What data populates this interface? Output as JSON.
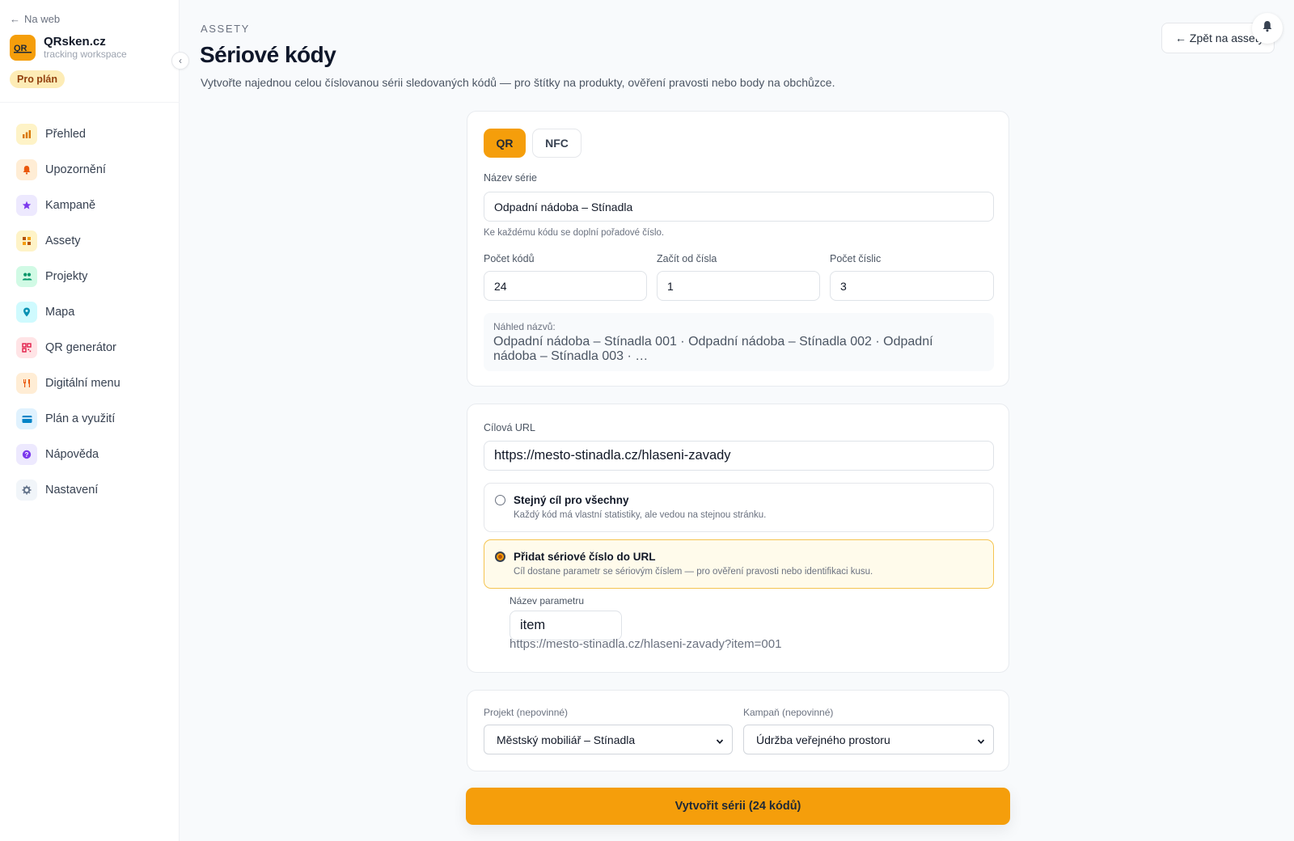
{
  "colors": {
    "accent": "#f59e0b",
    "accent_soft": "#fffbeb",
    "badge_bg": "#fdecb6"
  },
  "sidebar": {
    "back_link": "Na web",
    "brand_name": "QRsken.cz",
    "brand_sub": "tracking workspace",
    "plan_badge": "Pro plán",
    "items": [
      {
        "label": "Přehled",
        "icon": "bar-chart-icon"
      },
      {
        "label": "Upozornění",
        "icon": "bell-icon"
      },
      {
        "label": "Kampaně",
        "icon": "star-icon"
      },
      {
        "label": "Assety",
        "icon": "grid-icon"
      },
      {
        "label": "Projekty",
        "icon": "users-icon"
      },
      {
        "label": "Mapa",
        "icon": "map-pin-icon"
      },
      {
        "label": "QR generátor",
        "icon": "qr-icon"
      },
      {
        "label": "Digitální menu",
        "icon": "cutlery-icon"
      },
      {
        "label": "Plán a využití",
        "icon": "credit-card-icon"
      },
      {
        "label": "Nápověda",
        "icon": "help-icon"
      },
      {
        "label": "Nastavení",
        "icon": "gear-icon"
      }
    ]
  },
  "header": {
    "eyebrow": "ASSETY",
    "title": "Sériové kódy",
    "description": "Vytvořte najednou celou číslovanou sérii sledovaných kódů — pro štítky na produkty, ověření pravosti nebo body na obchůzce.",
    "back_button": "← Zpět na assety"
  },
  "series": {
    "type_tabs": [
      "QR",
      "NFC"
    ],
    "selected_type": "QR",
    "name_label": "Název série",
    "name_value": "Odpadní nádoba – Stínadla",
    "name_hint": "Ke každému kódu se doplní pořadové číslo.",
    "count_label": "Počet kódů",
    "count_value": "24",
    "start_label": "Začít od čísla",
    "start_value": "1",
    "digits_label": "Počet číslic",
    "digits_value": "3",
    "preview_label": "Náhled názvů:",
    "preview_text": "Odpadní nádoba – Stínadla 001 · Odpadní nádoba – Stínadla 002 · Odpadní nádoba – Stínadla 003 · …"
  },
  "target": {
    "url_label": "Cílová URL",
    "url_value": "https://mesto-stinadla.cz/hlaseni-zavady",
    "option_same_title": "Stejný cíl pro všechny",
    "option_same_desc": "Každý kód má vlastní statistiky, ale vedou na stejnou stránku.",
    "option_serial_title": "Přidat sériové číslo do URL",
    "option_serial_desc": "Cíl dostane parametr se sériovým číslem — pro ověření pravosti nebo identifikaci kusu.",
    "selected_option": "serial",
    "param_label": "Název parametru",
    "param_value": "item",
    "url_preview": "https://mesto-stinadla.cz/hlaseni-zavady?item=001"
  },
  "assignment": {
    "project_label": "Projekt (nepovinné)",
    "project_value": "Městský mobiliář – Stínadla",
    "campaign_label": "Kampaň (nepovinné)",
    "campaign_value": "Údržba veřejného prostoru"
  },
  "submit_label": "Vytvořit sérii (24 kódů)"
}
